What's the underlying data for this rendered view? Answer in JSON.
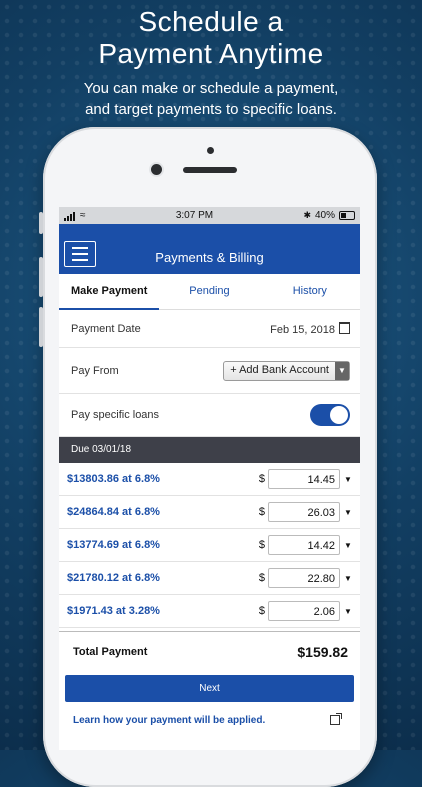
{
  "promo": {
    "headline_line1": "Schedule a",
    "headline_line2": "Payment Anytime",
    "sub_line1": "You can make or schedule a payment,",
    "sub_line2": "and target payments to specific loans."
  },
  "status_bar": {
    "time": "3:07 PM",
    "battery": "40%"
  },
  "app": {
    "title": "Payments & Billing"
  },
  "tabs": [
    {
      "label": "Make Payment",
      "active": true
    },
    {
      "label": "Pending",
      "active": false
    },
    {
      "label": "History",
      "active": false
    }
  ],
  "payment_date": {
    "label": "Payment Date",
    "value": "Feb 15, 2018"
  },
  "pay_from": {
    "label": "Pay From",
    "selected": "+ Add Bank Account"
  },
  "specific_loans": {
    "label": "Pay specific loans",
    "enabled": true
  },
  "due_header": "Due 03/01/18",
  "currency_symbol": "$",
  "loans": [
    {
      "label": "$13803.86 at 6.8%",
      "amount": "14.45"
    },
    {
      "label": "$24864.84 at 6.8%",
      "amount": "26.03"
    },
    {
      "label": "$13774.69 at 6.8%",
      "amount": "14.42"
    },
    {
      "label": "$21780.12 at 6.8%",
      "amount": "22.80"
    },
    {
      "label": "$1971.43 at 3.28%",
      "amount": "2.06"
    }
  ],
  "total": {
    "label": "Total Payment",
    "value": "$159.82"
  },
  "next_label": "Next",
  "learn_link": "Learn how your payment will be applied.",
  "colors": {
    "brand": "#1b4fa8",
    "due_bar": "#3e4049"
  }
}
